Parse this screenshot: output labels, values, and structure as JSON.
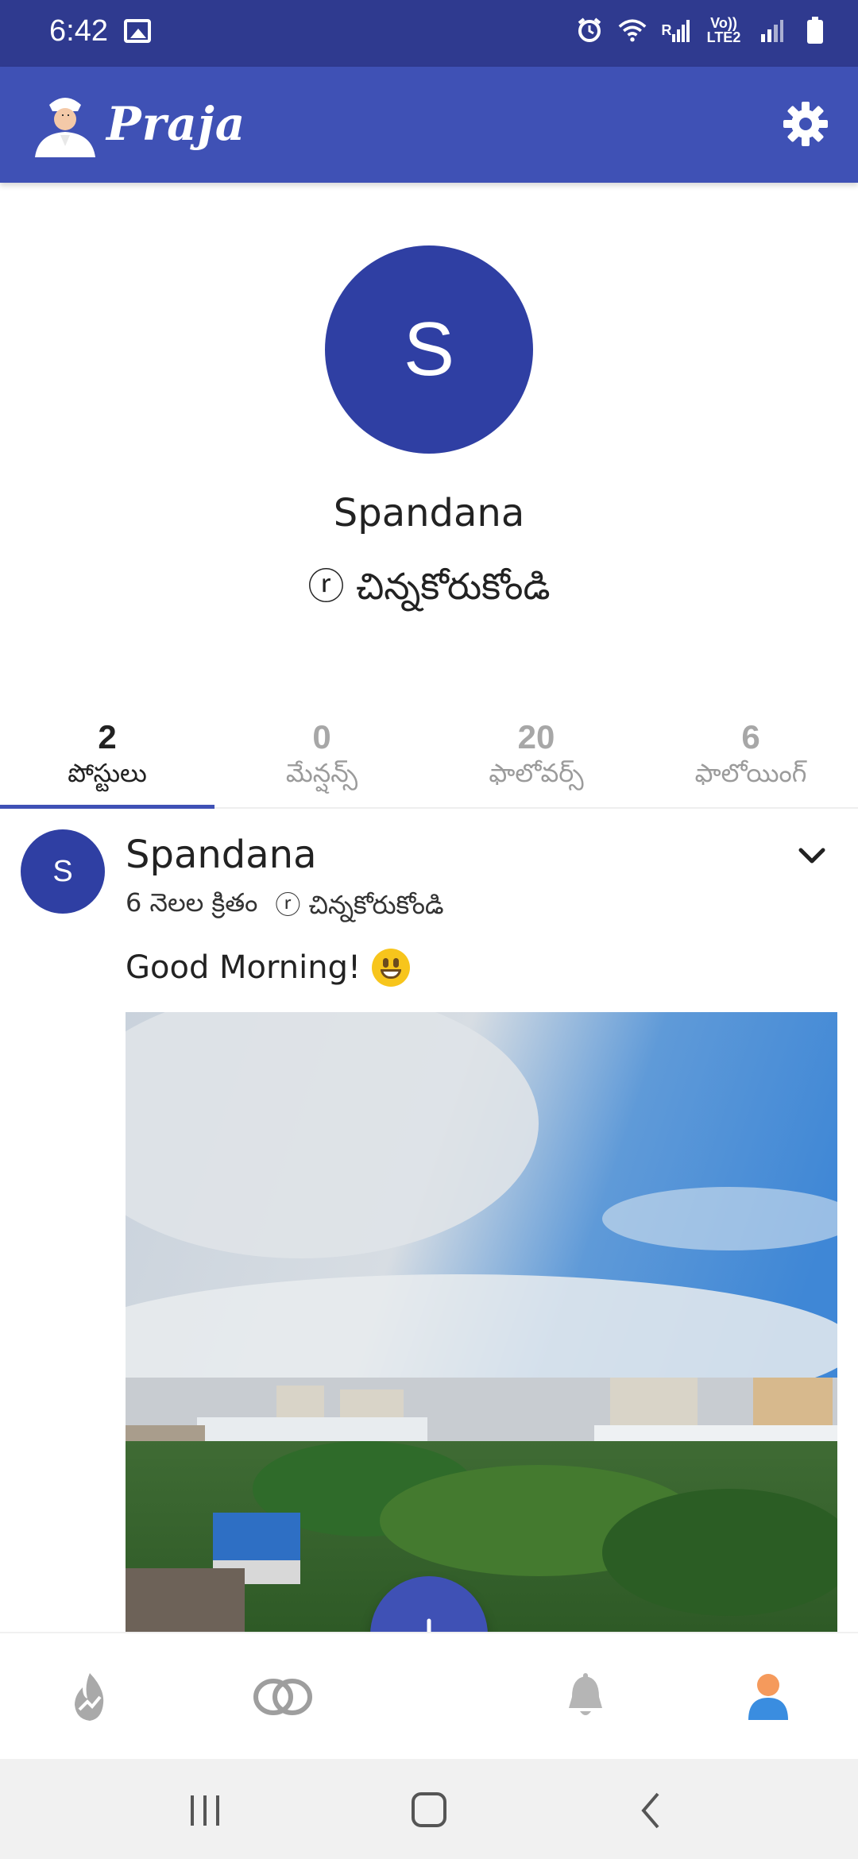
{
  "status_bar": {
    "time": "6:42",
    "signal_r": "R",
    "volte_label_1": "Vo))",
    "volte_label_2": "LTE2"
  },
  "app_bar": {
    "title": "Praja"
  },
  "profile": {
    "avatar_letter": "S",
    "name": "Spandana",
    "location": "ⓡ చిన్నకోరుకోండి"
  },
  "tabs": [
    {
      "count": "2",
      "label": "పోస్టులు",
      "active": true
    },
    {
      "count": "0",
      "label": "మేన్షన్స్",
      "active": false
    },
    {
      "count": "20",
      "label": "ఫాలోవర్స్",
      "active": false
    },
    {
      "count": "6",
      "label": "ఫాలోయింగ్",
      "active": false
    }
  ],
  "post": {
    "avatar_letter": "S",
    "author": "Spandana",
    "time_ago": "6 నెలల క్రితం",
    "location": "ⓡ  చిన్నకోరుకోండి",
    "text": "Good Morning!"
  },
  "bottom_nav": {
    "items": [
      "trending-icon",
      "circles-icon",
      "add-icon",
      "bell-icon",
      "profile-icon"
    ],
    "active": "profile-icon"
  },
  "colors": {
    "primary": "#3f51b5",
    "status_bar": "#2f3a8f",
    "avatar": "#2f3fa3"
  }
}
